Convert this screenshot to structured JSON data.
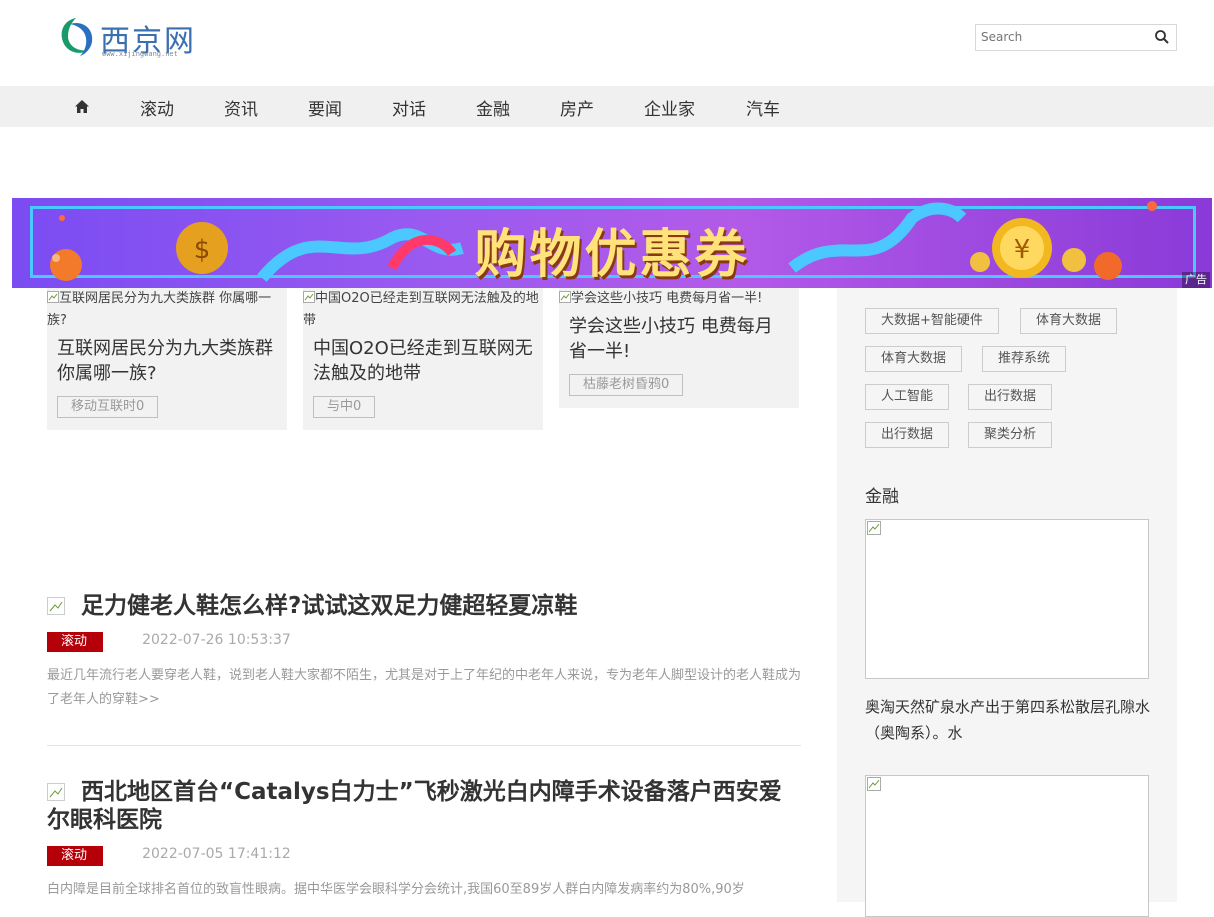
{
  "header": {
    "logo_text": "西京网",
    "logo_url": "www.xijingwang.net",
    "search_placeholder": "Search"
  },
  "nav": {
    "home_icon": "home-icon",
    "items": [
      "滚动",
      "资讯",
      "要闻",
      "对话",
      "金融",
      "房产",
      "企业家",
      "汽车"
    ]
  },
  "banner": {
    "title": "购物优惠券",
    "ad_label": "广告"
  },
  "cards": [
    {
      "alt": "互联网居民分为九大类族群 你属哪一族?",
      "title": "互联网居民分为九大类族群你属哪一族?",
      "tag": "移动互联时0"
    },
    {
      "alt": "中国O2O已经走到互联网无法触及的地带",
      "title": "中国O2O已经走到互联网无法触及的地带",
      "tag": "与中0"
    },
    {
      "alt": "学会这些小技巧 电费每月省一半!",
      "title": "学会这些小技巧 电费每月省一半!",
      "tag": "枯藤老树昏鸦0"
    }
  ],
  "articles": [
    {
      "title": "足力健老人鞋怎么样?试试这双足力健超轻夏凉鞋",
      "category": "滚动",
      "date": "2022-07-26 10:53:37",
      "summary": "最近几年流行老人要穿老人鞋，说到老人鞋大家都不陌生，尤其是对于上了年纪的中老年人来说，专为老年人脚型设计的老人鞋成为了老年人的穿鞋>>"
    },
    {
      "title": "西北地区首台“Catalys白力士”飞秒激光白内障手术设备落户西安爱尔眼科医院",
      "category": "滚动",
      "date": "2022-07-05 17:41:12",
      "summary": "白内障是目前全球排名首位的致盲性眼病。据中华医学会眼科学分会统计,我国60至89岁人群白内障发病率约为80%,90岁"
    }
  ],
  "sidebar": {
    "tags": [
      "大数据+智能硬件",
      "体育大数据",
      "体育大数据",
      "推荐系统",
      "人工智能",
      "出行数据",
      "出行数据",
      "聚类分析"
    ],
    "finance_heading": "金融",
    "finance_text": "奥淘天然矿泉水产出于第四系松散层孔隙水（奥陶系）。水"
  },
  "colors": {
    "nav_bg": "#f0f0f0",
    "badge_red": "#b5000a",
    "banner_purple": "#9a5af0",
    "logo_blue": "#3a6fb0"
  }
}
